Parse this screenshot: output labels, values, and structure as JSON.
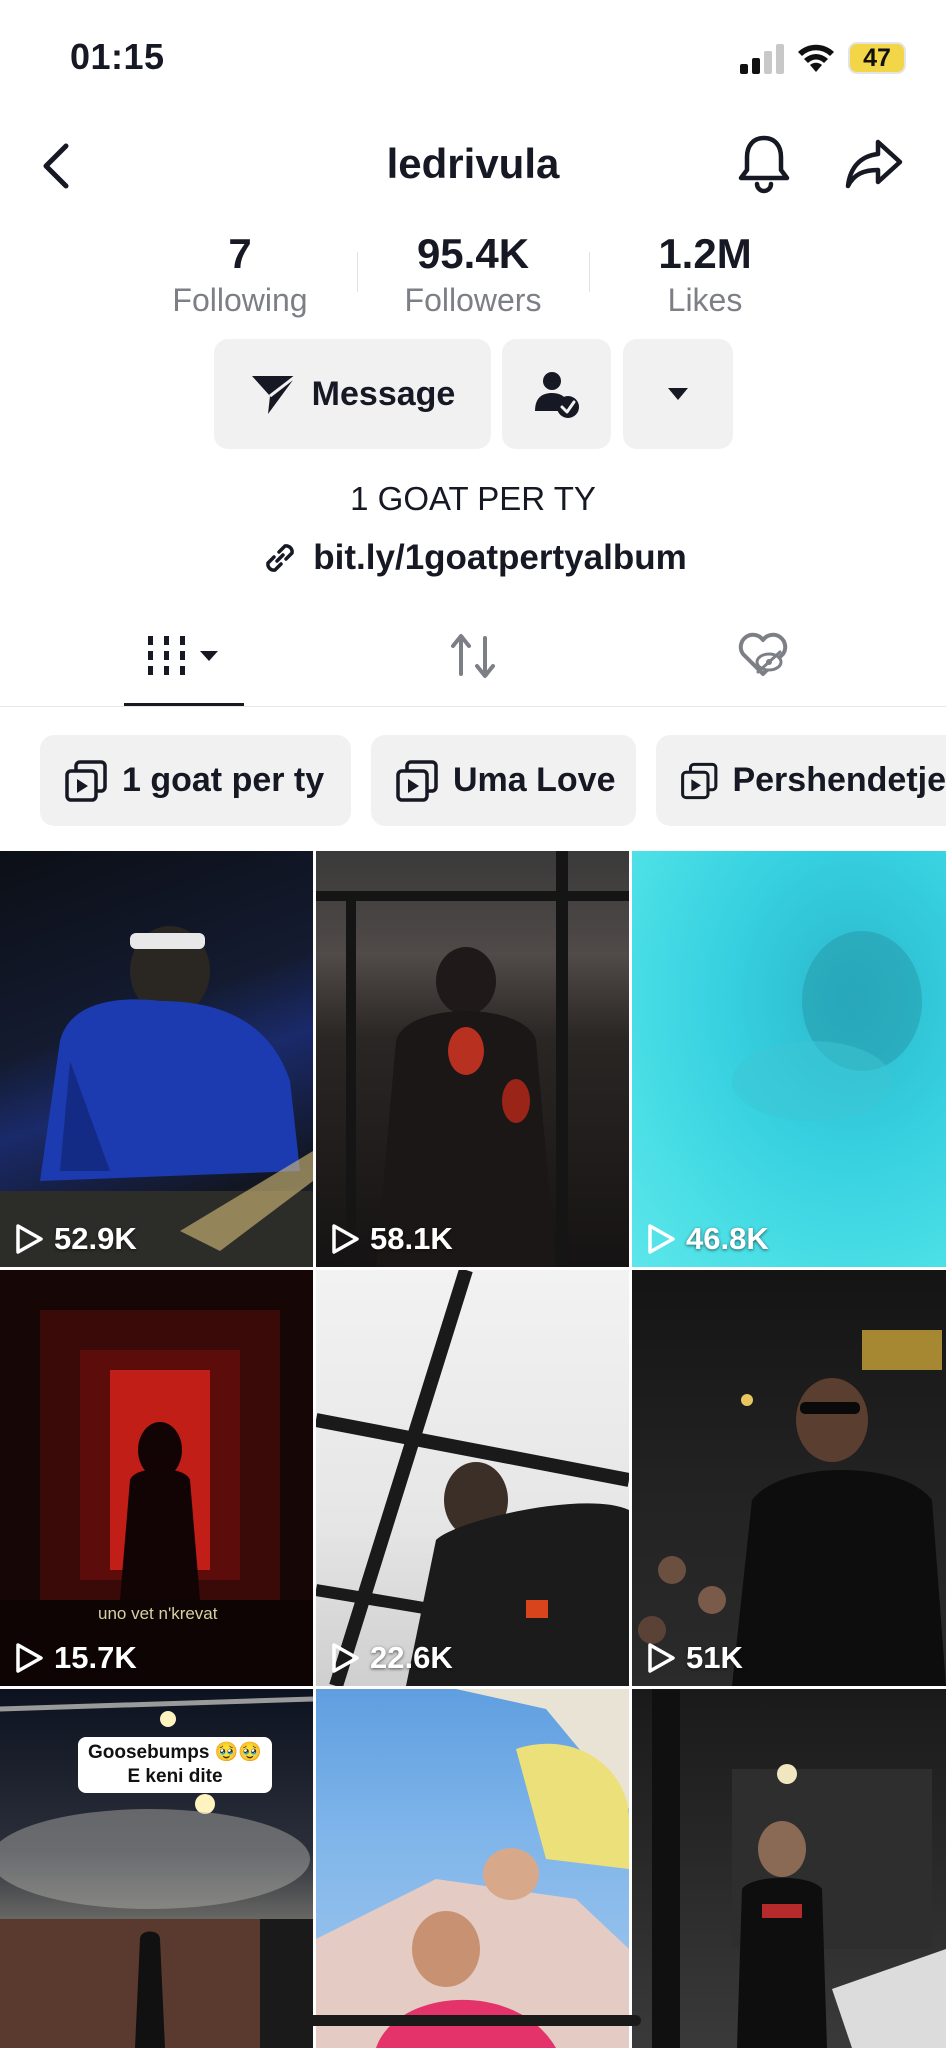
{
  "status_bar": {
    "time": "01:15",
    "battery": "47"
  },
  "header": {
    "username": "ledrivula"
  },
  "stats": [
    {
      "value": "7",
      "label": "Following"
    },
    {
      "value": "95.4K",
      "label": "Followers"
    },
    {
      "value": "1.2M",
      "label": "Likes"
    }
  ],
  "actions": {
    "message_label": "Message"
  },
  "bio": {
    "text": "1 GOAT PER TY",
    "link": "bit.ly/1goatpertyalbum"
  },
  "tabs": [
    {
      "icon": "grid-icon",
      "selected": true
    },
    {
      "icon": "repost-icon",
      "selected": false
    },
    {
      "icon": "liked-hidden-icon",
      "selected": false
    }
  ],
  "playlists": [
    {
      "label": "1 goat per ty"
    },
    {
      "label": "Uma Love"
    },
    {
      "label": "Pershendetje"
    }
  ],
  "videos": [
    {
      "views": "52.9K"
    },
    {
      "views": "58.1K"
    },
    {
      "views": "46.8K"
    },
    {
      "views": "15.7K",
      "overlay_text": "uno vet n'krevat"
    },
    {
      "views": "22.6K"
    },
    {
      "views": "51K"
    },
    {
      "views": "",
      "caption_line1": "Goosebumps 🥹🥹",
      "caption_line2": "E keni dite"
    },
    {
      "views": ""
    },
    {
      "views": ""
    }
  ],
  "colors": {
    "text": "#161823",
    "secondary": "#7d7f86",
    "button_bg": "#f1f1f2",
    "battery": "#f3d548"
  }
}
